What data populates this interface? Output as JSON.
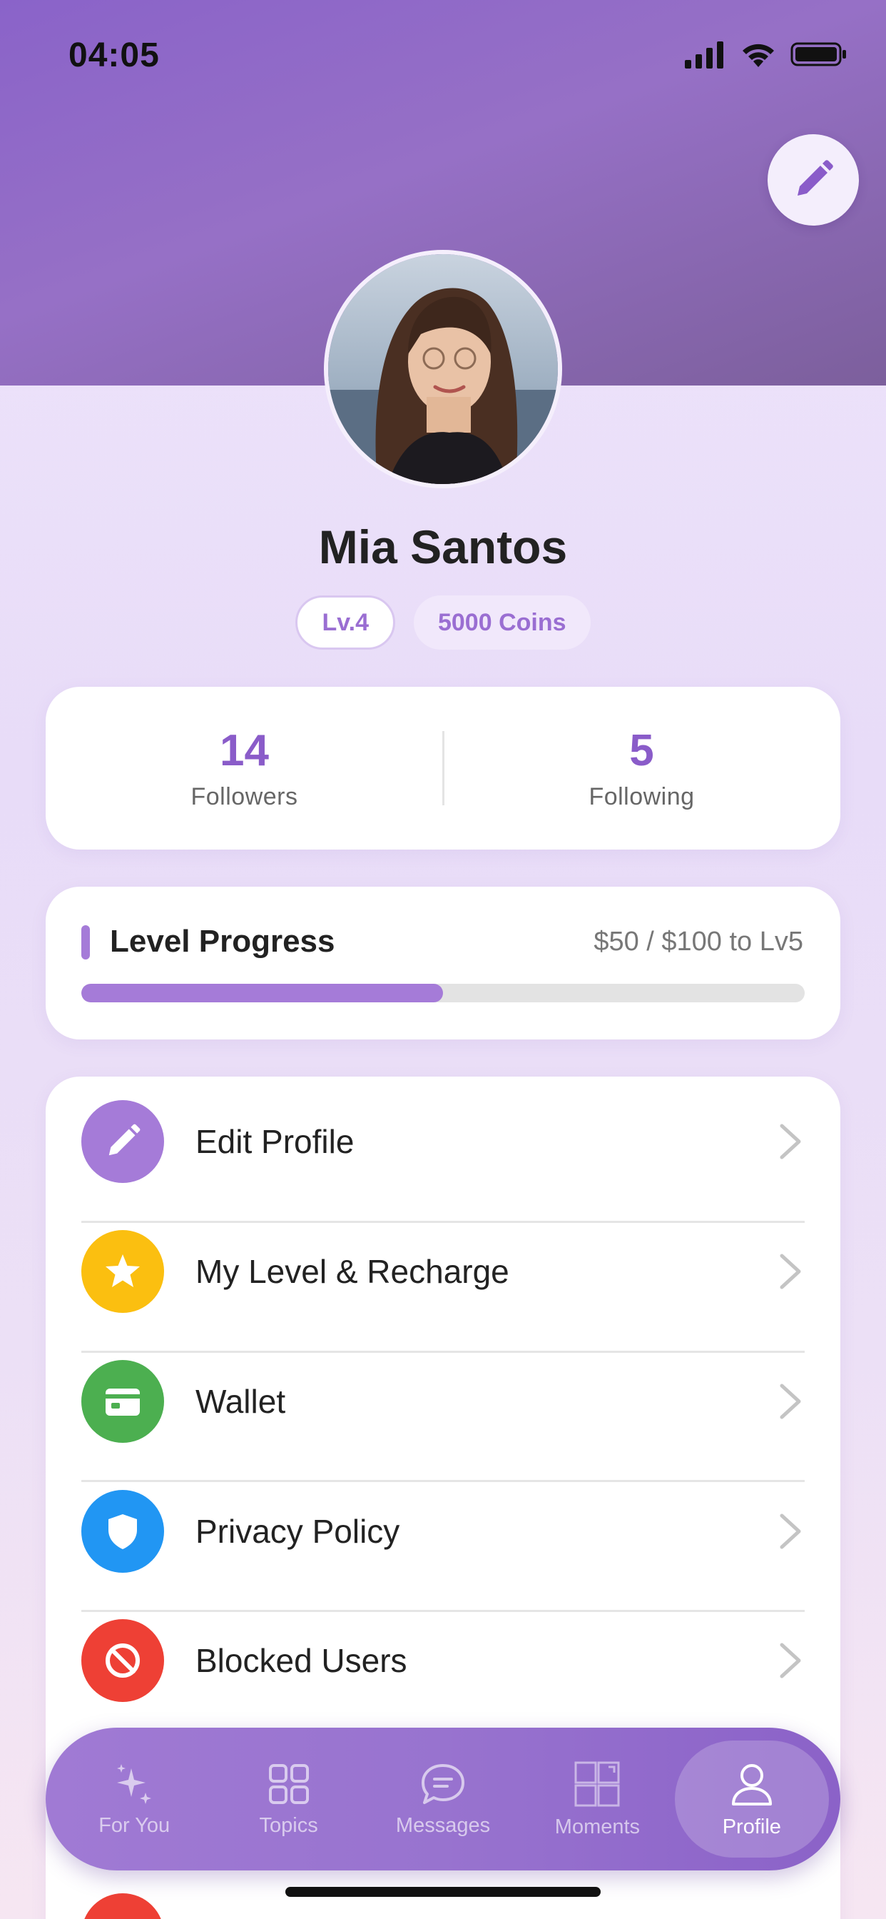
{
  "status_bar": {
    "time": "04:05"
  },
  "profile": {
    "name": "Mia Santos",
    "level_badge": "Lv.4",
    "coins_badge": "5000 Coins"
  },
  "stats": {
    "followers": {
      "value": "14",
      "label": "Followers"
    },
    "following": {
      "value": "5",
      "label": "Following"
    }
  },
  "level_progress": {
    "title": "Level Progress",
    "status": "$50 / $100 to Lv5",
    "fraction": 0.5
  },
  "menu": {
    "items": [
      {
        "label": "Edit Profile",
        "icon": "pencil-icon",
        "color": "#a57bd8"
      },
      {
        "label": "My Level & Recharge",
        "icon": "star-icon",
        "color": "#fbbf10"
      },
      {
        "label": "Wallet",
        "icon": "wallet-icon",
        "color": "#4caf50"
      },
      {
        "label": "Privacy Policy",
        "icon": "shield-icon",
        "color": "#2196f3"
      },
      {
        "label": "Blocked Users",
        "icon": "block-icon",
        "color": "#ee4035"
      }
    ]
  },
  "tab_bar": {
    "tabs": [
      {
        "label": "For You",
        "icon": "sparkles-icon",
        "active": false
      },
      {
        "label": "Topics",
        "icon": "grid-icon",
        "active": false
      },
      {
        "label": "Messages",
        "icon": "chat-bubble-icon",
        "active": false
      },
      {
        "label": "Moments",
        "icon": "moments-icon",
        "active": false
      },
      {
        "label": "Profile",
        "icon": "person-icon",
        "active": true
      }
    ]
  },
  "colors": {
    "accent": "#a57bd8",
    "header": "#8a63c9",
    "stat_value": "#8a5cc9"
  }
}
